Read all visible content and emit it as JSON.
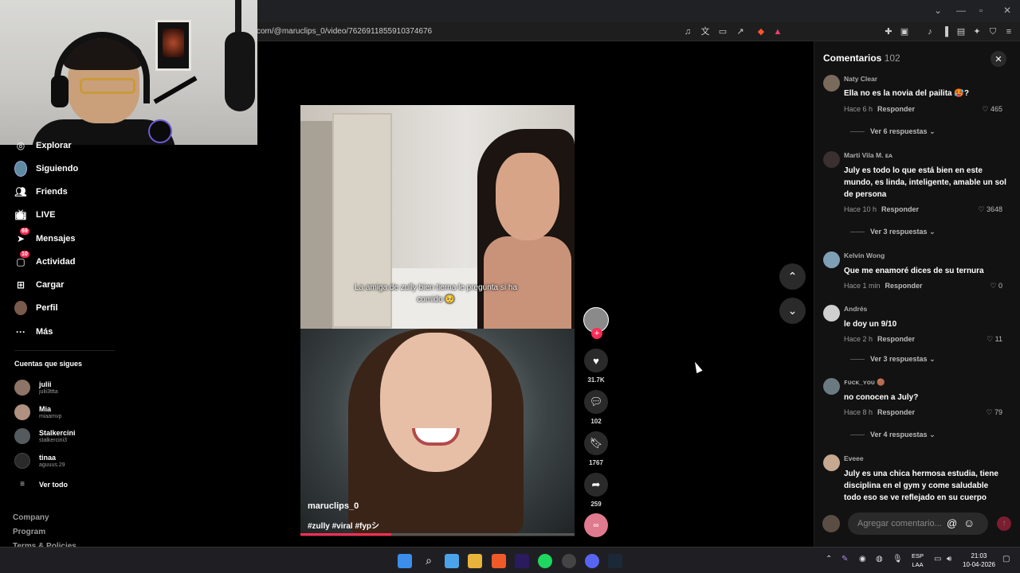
{
  "browser": {
    "url": "com/@maruclips_0/video/7626911855910374676"
  },
  "nav": {
    "items": [
      {
        "label": "Explorar",
        "icon": "compass-icon",
        "badge": ""
      },
      {
        "label": "Siguiendo",
        "icon": "avatar",
        "badge": ""
      },
      {
        "label": "Friends",
        "icon": "friends-icon",
        "badge": ""
      },
      {
        "label": "LIVE",
        "icon": "live-tv-icon",
        "badge": ""
      },
      {
        "label": "Mensajes",
        "icon": "send-icon",
        "badge": "69"
      },
      {
        "label": "Actividad",
        "icon": "activity-icon",
        "badge": "10"
      },
      {
        "label": "Cargar",
        "icon": "upload-icon",
        "badge": ""
      },
      {
        "label": "Perfil",
        "icon": "profile-avatar",
        "badge": ""
      },
      {
        "label": "Más",
        "icon": "more-icon",
        "badge": ""
      }
    ],
    "following_title": "Cuentas que sigues",
    "following": [
      {
        "name": "julii",
        "handle": "julii3ttta",
        "color": "#8c7466"
      },
      {
        "name": "Mia",
        "handle": "miaamvp",
        "color": "#b09080"
      },
      {
        "name": "Stalkercini",
        "handle": "stalkercini3",
        "color": "#555a5e"
      },
      {
        "name": "tinaa",
        "handle": "aguuus.29",
        "color": "#2a2a2a"
      }
    ],
    "see_all": "Ver todo",
    "footer": [
      "Company",
      "Program",
      "Terms & Policies"
    ]
  },
  "video": {
    "caption": "La amiga de zully bien tierna le pregunta si ha comido 🥺",
    "username": "maruclips_0",
    "tags": "#zully #viral #fypシ",
    "progress": 0.33
  },
  "actions": {
    "likes": "31.7K",
    "comments": "102",
    "saves": "1767",
    "shares": "259"
  },
  "comments_panel": {
    "title": "Comentarios",
    "count": "102",
    "input_placeholder": "Agregar comentario...",
    "comments": [
      {
        "user": "Naty Clear",
        "text": "Ella no es la novia del pailita 🥵?",
        "time": "Hace 6 h",
        "reply": "Responder",
        "likes": "465",
        "replies": "Ver 6 respuestas",
        "color": "#7a6a5c"
      },
      {
        "user": "Marti Vila M. ᴇᴀ",
        "text": "July es todo lo que está bien en este mundo, es linda, inteligente, amable un sol de persona",
        "time": "Hace 10 h",
        "reply": "Responder",
        "likes": "3648",
        "replies": "Ver 3 respuestas",
        "color": "#3a3030"
      },
      {
        "user": "Kelvin Wong",
        "text": "Que me enamoré dices de su ternura",
        "time": "Hace 1 min",
        "reply": "Responder",
        "likes": "0",
        "replies": "",
        "color": "#7f9fb5"
      },
      {
        "user": "Andrés",
        "text": "le doy un 9/10",
        "time": "Hace 2 h",
        "reply": "Responder",
        "likes": "11",
        "replies": "Ver 3 respuestas",
        "color": "#cfcfcf"
      },
      {
        "user": "ꜰᴜᴄᴋ_ʏᴏᴜ 🟤",
        "text": "no conocen a July?",
        "time": "Hace 8 h",
        "reply": "Responder",
        "likes": "79",
        "replies": "Ver 4 respuestas",
        "color": "#6a7a80"
      },
      {
        "user": "Eveee",
        "text": "July es una chica hermosa estudia, tiene disciplina en el gym y come saludable todo eso se ve reflejado en su cuerpo",
        "time": "",
        "reply": "",
        "likes": "",
        "replies": "",
        "color": "#c7a890"
      }
    ]
  },
  "taskbar": {
    "lang_top": "ESP",
    "lang_bottom": "LAA",
    "time": "21:03",
    "date": "10-04-2026"
  }
}
